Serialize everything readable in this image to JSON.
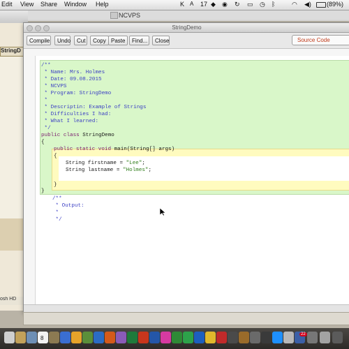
{
  "menubar": {
    "items": [
      "Edit",
      "View",
      "Share",
      "Window",
      "Help"
    ],
    "battery": "(89%)",
    "tray_app_badge": "17"
  },
  "back_window": {
    "tab_label": "StringD",
    "footer_label": "osh HD"
  },
  "behind_title": "NCVPS",
  "window": {
    "title": "StringDemo",
    "toolbar": [
      "Compile",
      "Undo",
      "Cut",
      "Copy",
      "Paste",
      "Find...",
      "Close"
    ],
    "view_select": "Source Code"
  },
  "code": {
    "comment_header": [
      "/**",
      " * Name: Mrs. Holmes",
      " * Date: 09.08.2015",
      " * NCVPS",
      " * Program: StringDemo",
      " *",
      " * Descriptin: Example of Strings",
      " * Difficulties I had:",
      " * What I learned:",
      " */"
    ],
    "class_kw": "public class",
    "class_name": " StringDemo",
    "open_brace": "{",
    "method_kw": "public static void",
    "method_sig": " main(String[] args)",
    "method_open": "{",
    "line1_prefix": "String firstname = ",
    "line1_string": "\"Lee\"",
    "line1_end": ";",
    "line2_prefix": "String lastname = ",
    "line2_string": "\"Holmes\"",
    "line2_end": ";",
    "method_close": "}",
    "class_close": "}",
    "comment_footer": [
      "/**",
      " * Output:",
      " *",
      " */"
    ]
  },
  "dock": {
    "calendar_day": "8",
    "badge": "22"
  }
}
